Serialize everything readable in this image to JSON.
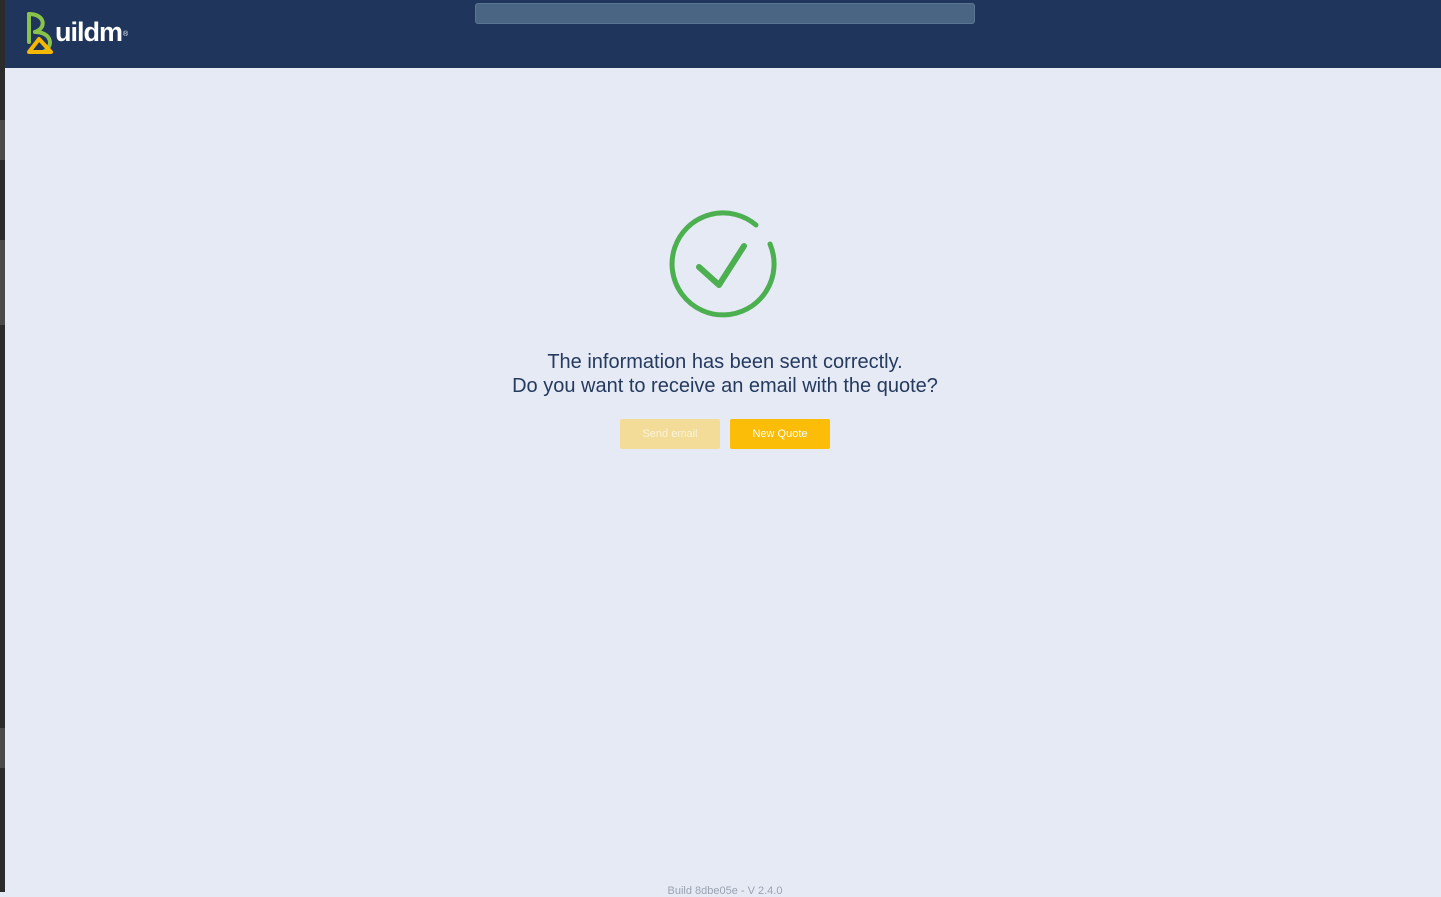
{
  "header": {
    "logo_text": "uildm",
    "logo_mark": "B",
    "search": {
      "placeholder": "",
      "value": ""
    }
  },
  "main": {
    "status_icon": "check-circle-icon",
    "message_line1": "The information has been sent correctly.",
    "message_line2": "Do you want to receive an email with the quote?",
    "send_email_label": "Send email",
    "new_quote_label": "New Quote"
  },
  "footer": {
    "build_text": "Build 8dbe05e - V 2.4.0"
  },
  "colors": {
    "header_bg": "#1f355b",
    "page_bg": "#e6eaf5",
    "success_green": "#4caf50",
    "accent_yellow": "#fbbd08",
    "text_navy": "#243a5e"
  }
}
